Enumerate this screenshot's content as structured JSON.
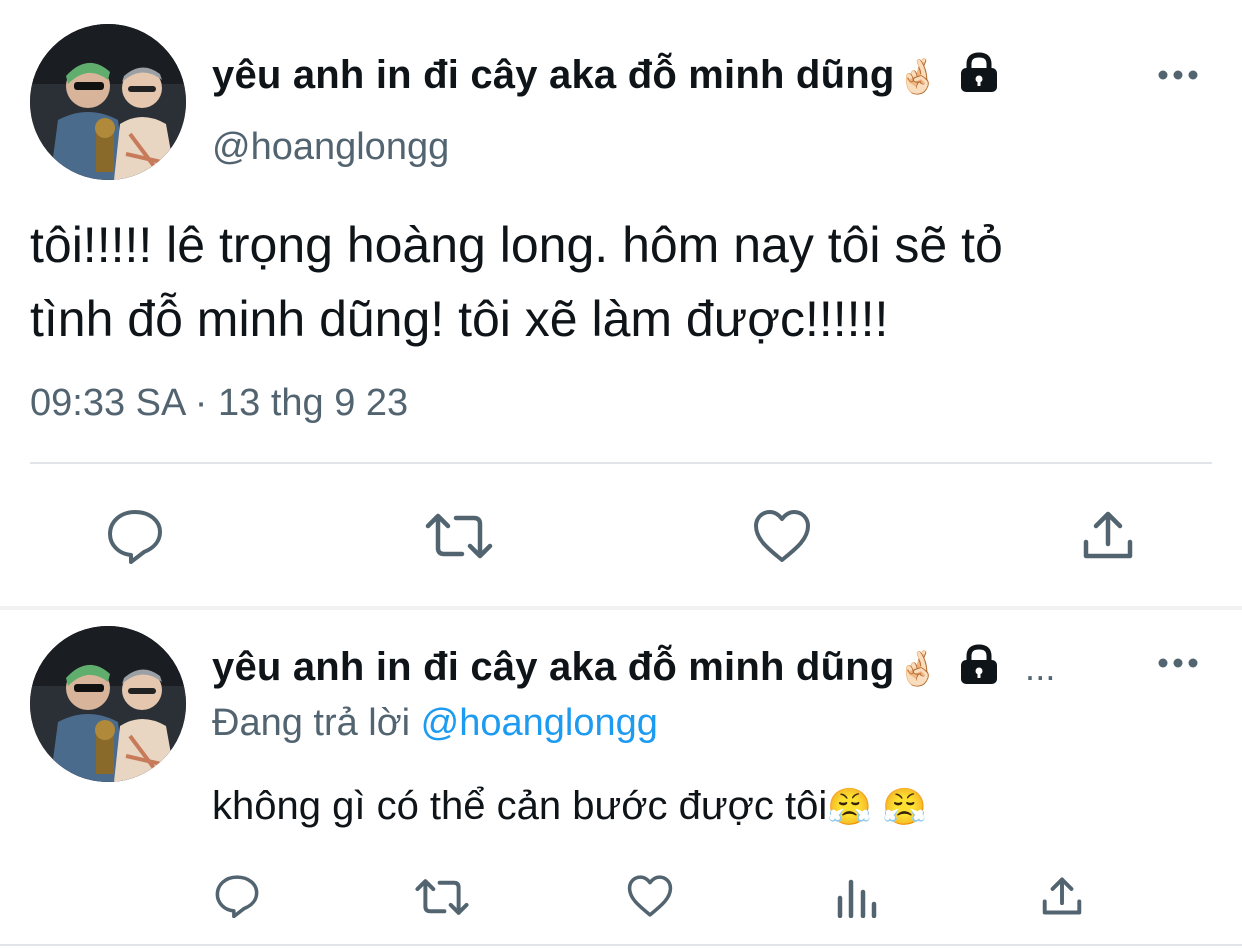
{
  "tweet": {
    "display_name": "yêu anh in đi cây aka đỗ minh dũng",
    "name_emoji": "🤞🏻",
    "handle": "@hoanglongg",
    "text": "tôi!!!!! lê trọng hoàng long. hôm nay tôi sẽ tỏ\ntình đỗ minh dũng! tôi xẽ làm được!!!!!!",
    "timestamp": "09:33 SA · 13 thg 9 23",
    "actions": [
      "reply-icon",
      "retweet-icon",
      "like-icon",
      "share-icon"
    ]
  },
  "reply": {
    "display_name": "yêu anh in đi cây aka đỗ minh dũng",
    "name_emoji": "🤞🏻",
    "ellipsis": "...",
    "replying_to_label": "Đang trả lời",
    "replying_to_handle": "@hoanglongg",
    "text": "không gì có thể cản bước được tôi",
    "text_emojis": "😤 😤",
    "actions": [
      "reply-icon",
      "retweet-icon",
      "like-icon",
      "analytics-icon",
      "share-icon"
    ]
  },
  "colors": {
    "text": "#0f1419",
    "secondary": "#536471",
    "link": "#1d9bf0",
    "divider": "#e1e4e8"
  }
}
